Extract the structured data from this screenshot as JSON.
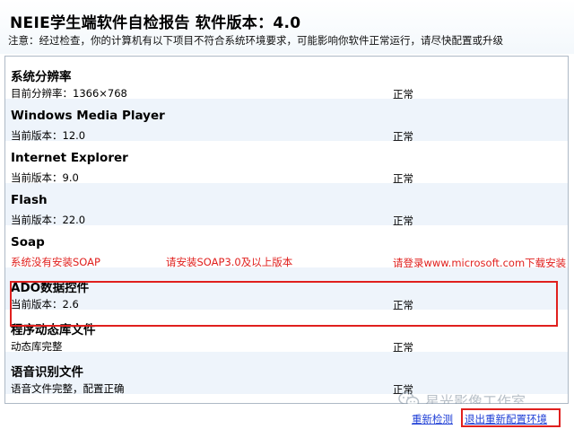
{
  "header": {
    "title": "NEIE学生端软件自检报告  软件版本：4.0",
    "notice": "注意：经过检查，你的计算机有以下项目不符合系统环境要求，可能影响你软件正常运行，请尽快配置或升级"
  },
  "items": [
    {
      "title": "系统分辨率",
      "detail": "目前分辨率：1366×768",
      "requirement": "",
      "status": "正常",
      "error": false
    },
    {
      "title": "Windows Media Player",
      "detail": "当前版本：12.0",
      "requirement": "",
      "status": "正常",
      "error": false
    },
    {
      "title": "Internet Explorer",
      "detail": "当前版本：9.0",
      "requirement": "",
      "status": "正常",
      "error": false
    },
    {
      "title": "Flash",
      "detail": "当前版本：22.0",
      "requirement": "",
      "status": "正常",
      "error": false
    },
    {
      "title": "Soap",
      "detail": "系统没有安装SOAP",
      "requirement": "请安装SOAP3.0及以上版本",
      "status": "请登录www.microsoft.com下载安装",
      "error": true
    },
    {
      "title": "ADO数据控件",
      "detail": "当前版本：2.6",
      "requirement": "",
      "status": "正常",
      "error": false
    },
    {
      "title": "程序动态库文件",
      "detail": "动态库完整",
      "requirement": "",
      "status": "正常",
      "error": false
    },
    {
      "title": "语音识别文件",
      "detail": "语音文件完整，配置正确",
      "requirement": "",
      "status": "正常",
      "error": false
    }
  ],
  "footer": {
    "recheck_label": "重新检测",
    "exit_label": "退出重新配置环境"
  },
  "watermark": {
    "text": "星光影像工作室",
    "icon": "wechat-icon"
  },
  "colors": {
    "error": "#e0201e",
    "link": "#1f3fd6",
    "alt_row": "#eef4fb"
  }
}
